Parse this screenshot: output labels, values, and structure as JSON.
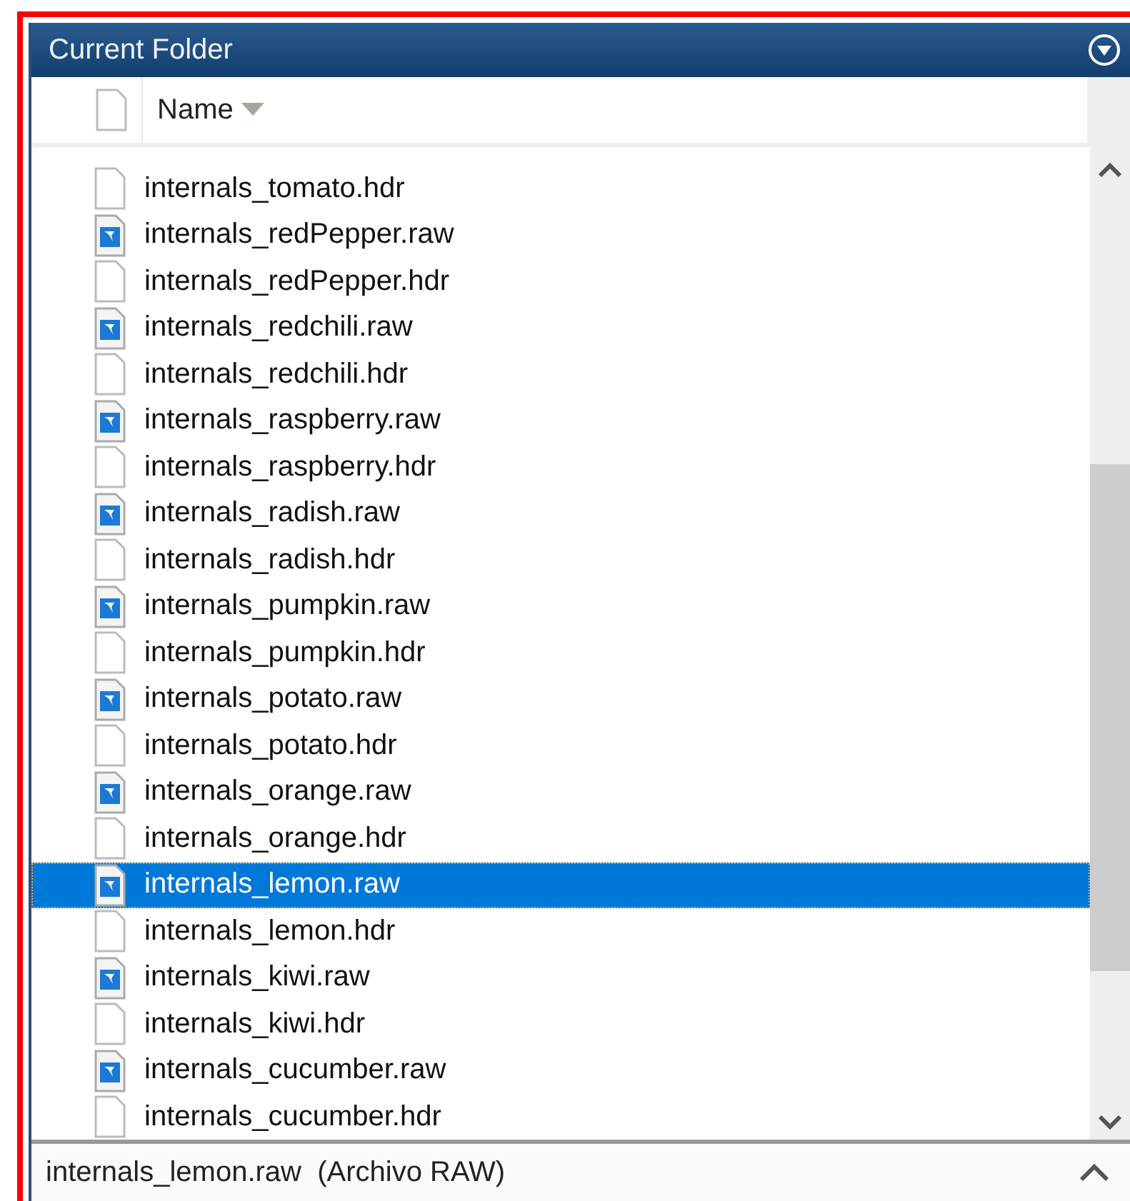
{
  "panel": {
    "title": "Current Folder"
  },
  "columns": [
    {
      "label": "Name"
    }
  ],
  "files": [
    {
      "name": "internals_tomato.hdr",
      "kind": "hdr",
      "selected": false
    },
    {
      "name": "internals_redPepper.raw",
      "kind": "raw",
      "selected": false
    },
    {
      "name": "internals_redPepper.hdr",
      "kind": "hdr",
      "selected": false
    },
    {
      "name": "internals_redchili.raw",
      "kind": "raw",
      "selected": false
    },
    {
      "name": "internals_redchili.hdr",
      "kind": "hdr",
      "selected": false
    },
    {
      "name": "internals_raspberry.raw",
      "kind": "raw",
      "selected": false
    },
    {
      "name": "internals_raspberry.hdr",
      "kind": "hdr",
      "selected": false
    },
    {
      "name": "internals_radish.raw",
      "kind": "raw",
      "selected": false
    },
    {
      "name": "internals_radish.hdr",
      "kind": "hdr",
      "selected": false
    },
    {
      "name": "internals_pumpkin.raw",
      "kind": "raw",
      "selected": false
    },
    {
      "name": "internals_pumpkin.hdr",
      "kind": "hdr",
      "selected": false
    },
    {
      "name": "internals_potato.raw",
      "kind": "raw",
      "selected": false
    },
    {
      "name": "internals_potato.hdr",
      "kind": "hdr",
      "selected": false
    },
    {
      "name": "internals_orange.raw",
      "kind": "raw",
      "selected": false
    },
    {
      "name": "internals_orange.hdr",
      "kind": "hdr",
      "selected": false
    },
    {
      "name": "internals_lemon.raw",
      "kind": "raw",
      "selected": true
    },
    {
      "name": "internals_lemon.hdr",
      "kind": "hdr",
      "selected": false
    },
    {
      "name": "internals_kiwi.raw",
      "kind": "raw",
      "selected": false
    },
    {
      "name": "internals_kiwi.hdr",
      "kind": "hdr",
      "selected": false
    },
    {
      "name": "internals_cucumber.raw",
      "kind": "raw",
      "selected": false
    },
    {
      "name": "internals_cucumber.hdr",
      "kind": "hdr",
      "selected": false
    }
  ],
  "details": {
    "text": "internals_lemon.raw  (Archivo RAW)"
  }
}
